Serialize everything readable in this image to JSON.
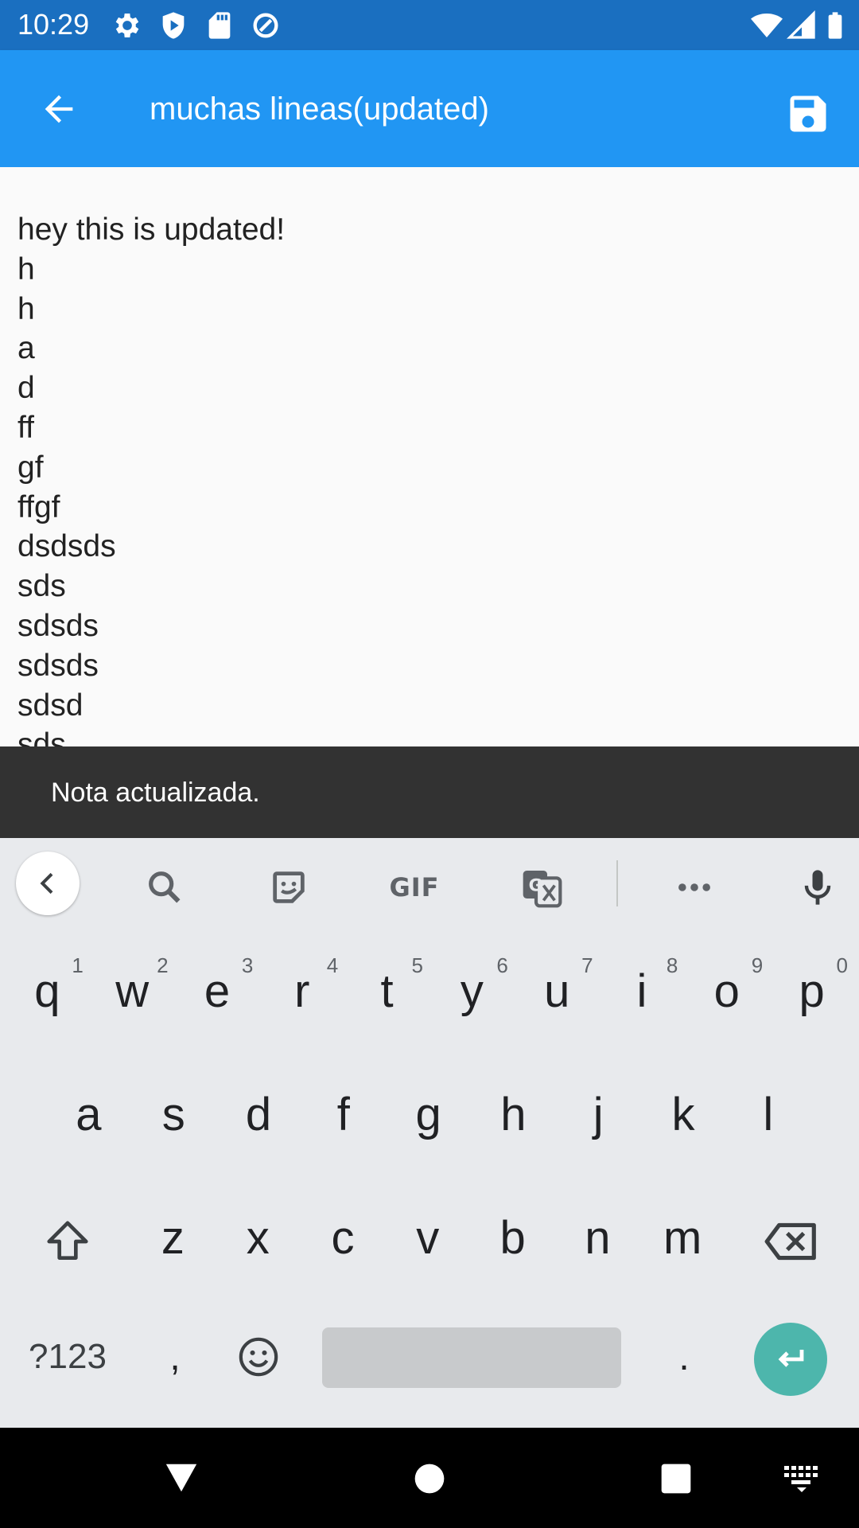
{
  "status_bar": {
    "time": "10:29",
    "icons": [
      "settings-icon",
      "shield-icon",
      "sd-card-icon",
      "data-saver-icon",
      "wifi-icon",
      "signal-icon",
      "battery-icon"
    ]
  },
  "app_bar": {
    "title": "muchas lineas(updated)",
    "back_icon": "arrow-back-icon",
    "save_icon": "save-icon",
    "color": "#2196f3"
  },
  "editor": {
    "lines": [
      "hey this is updated!",
      "h",
      "h",
      "a",
      "d",
      "ff",
      "gf",
      "ffgf",
      "dsdsds",
      "sds",
      "sdsds",
      "sdsds",
      "sdsd",
      "sds"
    ]
  },
  "snackbar": {
    "message": "Nota actualizada."
  },
  "keyboard": {
    "toolbar": [
      "chevron-left-icon",
      "search-icon",
      "sticker-icon",
      "gif-icon",
      "translate-icon",
      "more-icon",
      "mic-icon"
    ],
    "gif_label": "GIF",
    "row1": [
      {
        "key": "q",
        "hint": "1"
      },
      {
        "key": "w",
        "hint": "2"
      },
      {
        "key": "e",
        "hint": "3"
      },
      {
        "key": "r",
        "hint": "4"
      },
      {
        "key": "t",
        "hint": "5"
      },
      {
        "key": "y",
        "hint": "6"
      },
      {
        "key": "u",
        "hint": "7"
      },
      {
        "key": "i",
        "hint": "8"
      },
      {
        "key": "o",
        "hint": "9"
      },
      {
        "key": "p",
        "hint": "0"
      }
    ],
    "row2": [
      "a",
      "s",
      "d",
      "f",
      "g",
      "h",
      "j",
      "k",
      "l"
    ],
    "row3": [
      "z",
      "x",
      "c",
      "v",
      "b",
      "n",
      "m"
    ],
    "symbols_label": "?123",
    "comma": ",",
    "period": ".",
    "accent_color": "#4db6ac"
  },
  "nav_bar": {
    "icons": [
      "back-triangle-icon",
      "home-circle-icon",
      "recents-square-icon",
      "keyboard-switch-icon"
    ]
  }
}
